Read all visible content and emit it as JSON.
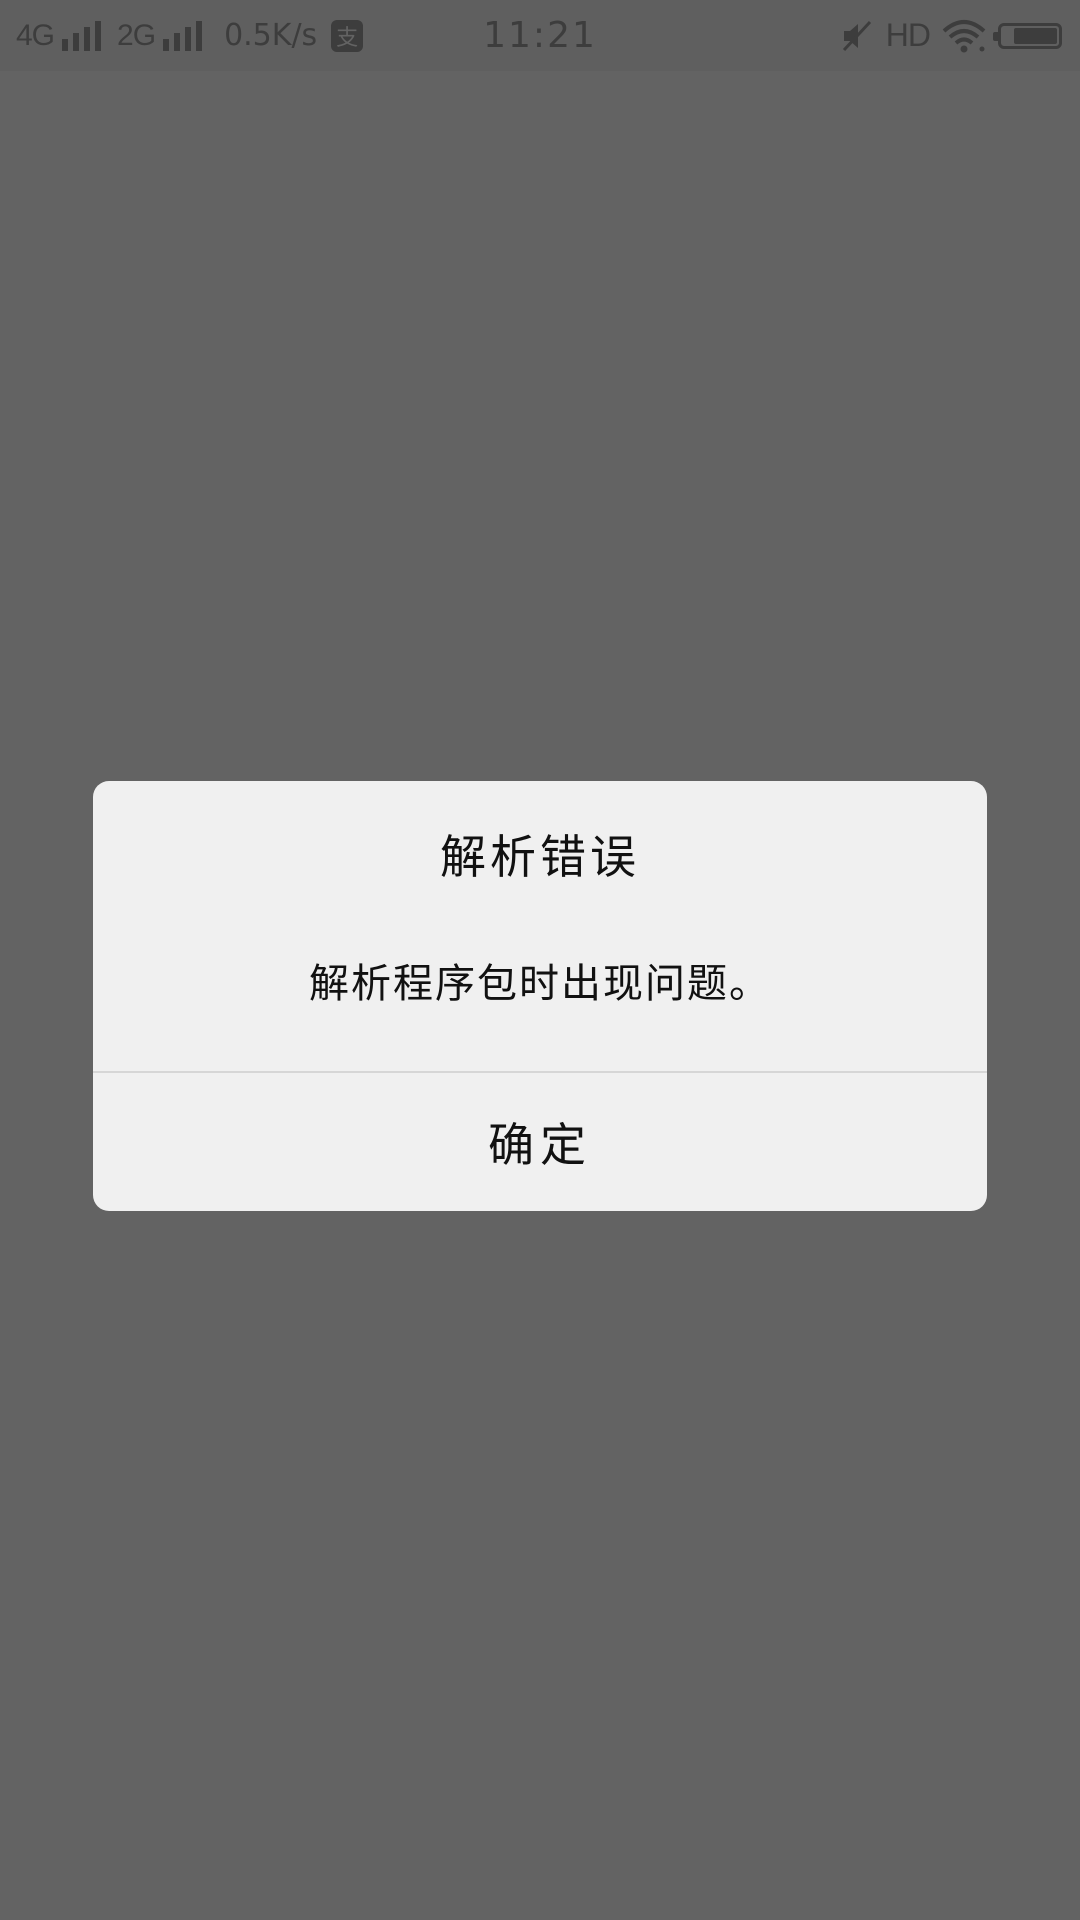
{
  "status_bar": {
    "network1": "4G",
    "network2": "2G",
    "speed": "0.5K/s",
    "app_icon": "支",
    "time": "11:21",
    "hd": "HD",
    "battery_level": 0.8
  },
  "dialog": {
    "title": "解析错误",
    "message": "解析程序包时出现问题。",
    "ok_label": "确定"
  },
  "icons": {
    "signal": "signal-bars-icon",
    "mute": "mute-icon",
    "wifi": "wifi-icon",
    "battery": "battery-icon",
    "app": "alipay-notification-icon"
  }
}
